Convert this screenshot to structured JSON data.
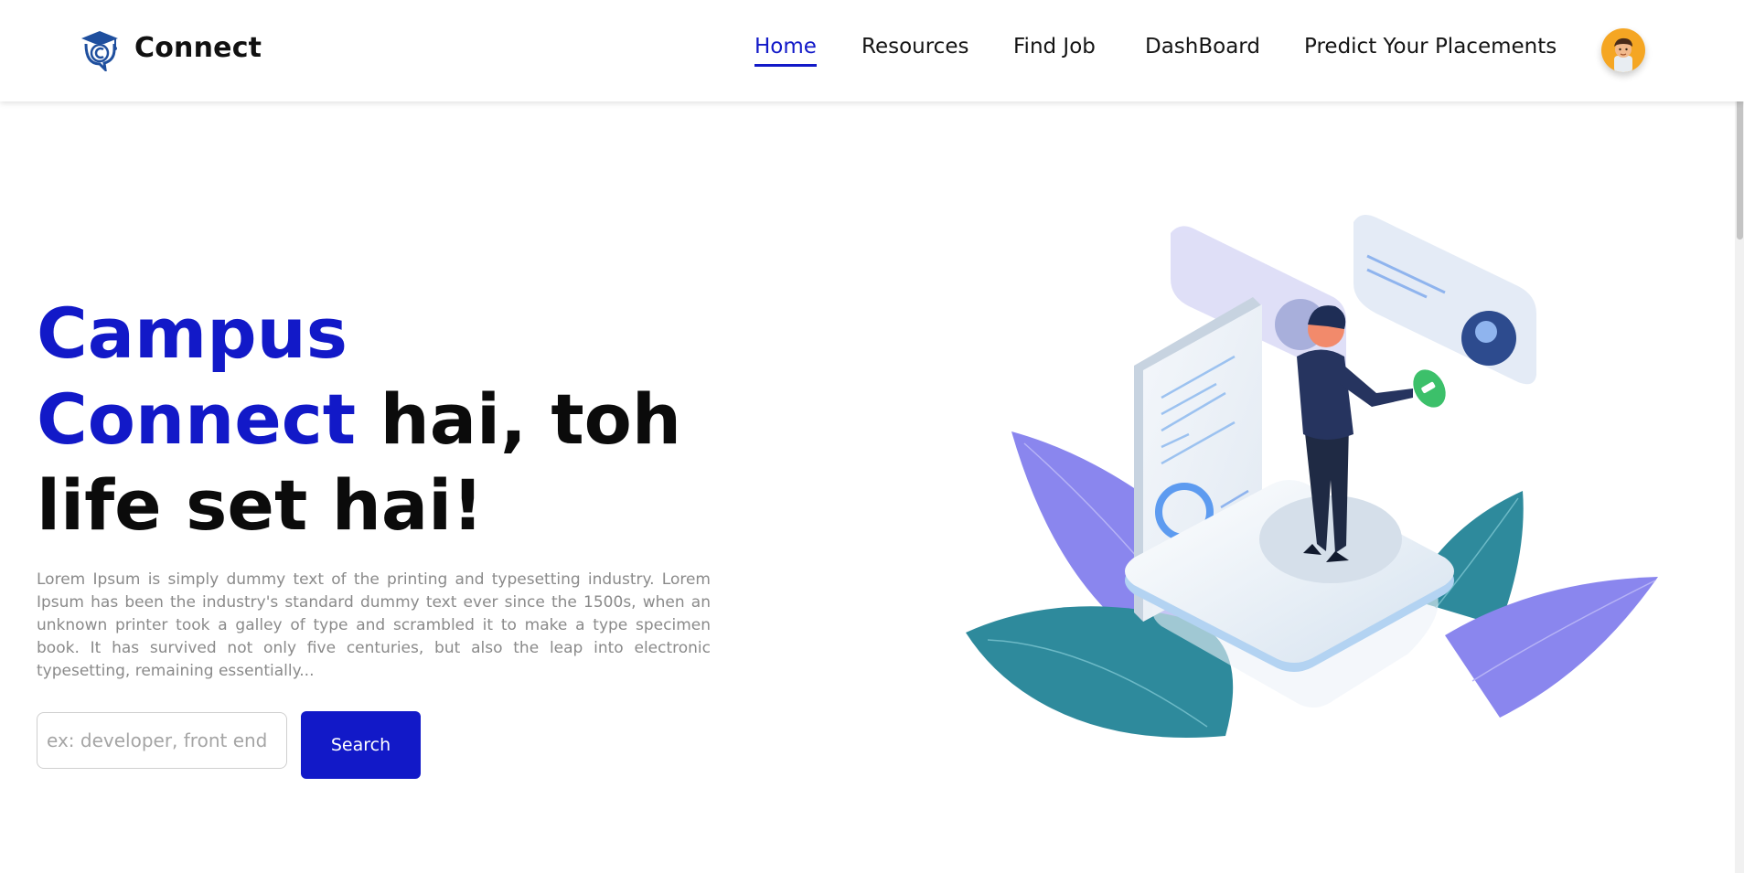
{
  "brand": {
    "name": "Connect",
    "logo_icon": "graduation-cap-c-icon"
  },
  "nav": {
    "items": [
      {
        "label": "Home",
        "active": true
      },
      {
        "label": "Resources",
        "active": false
      },
      {
        "label": "Find Job",
        "active": false
      },
      {
        "label": "DashBoard",
        "active": false
      },
      {
        "label": "Predict Your Placements",
        "active": false
      }
    ],
    "avatar_icon": "user-avatar-icon"
  },
  "hero": {
    "title_line1": "Campus",
    "title_line2_blue": "Connect",
    "title_line2_rest": " hai, toh",
    "title_line3": "life set hai!",
    "description": "Lorem Ipsum is simply dummy text of the printing and typesetting industry. Lorem Ipsum has been the industry's standard dummy text ever since the 1500s, when an unknown printer took a galley of type and scrambled it to make a type specimen book. It has survived not only five centuries, but also the leap into electronic typesetting, remaining essentially...",
    "search": {
      "placeholder": "ex: developer, front end",
      "value": "",
      "button_label": "Search"
    }
  },
  "colors": {
    "accent": "#1219c8",
    "text": "#111111",
    "muted": "#8a8a8a",
    "avatar_bg": "#f5a623"
  },
  "illustration_icon": "businessman-with-profile-cards-illustration"
}
